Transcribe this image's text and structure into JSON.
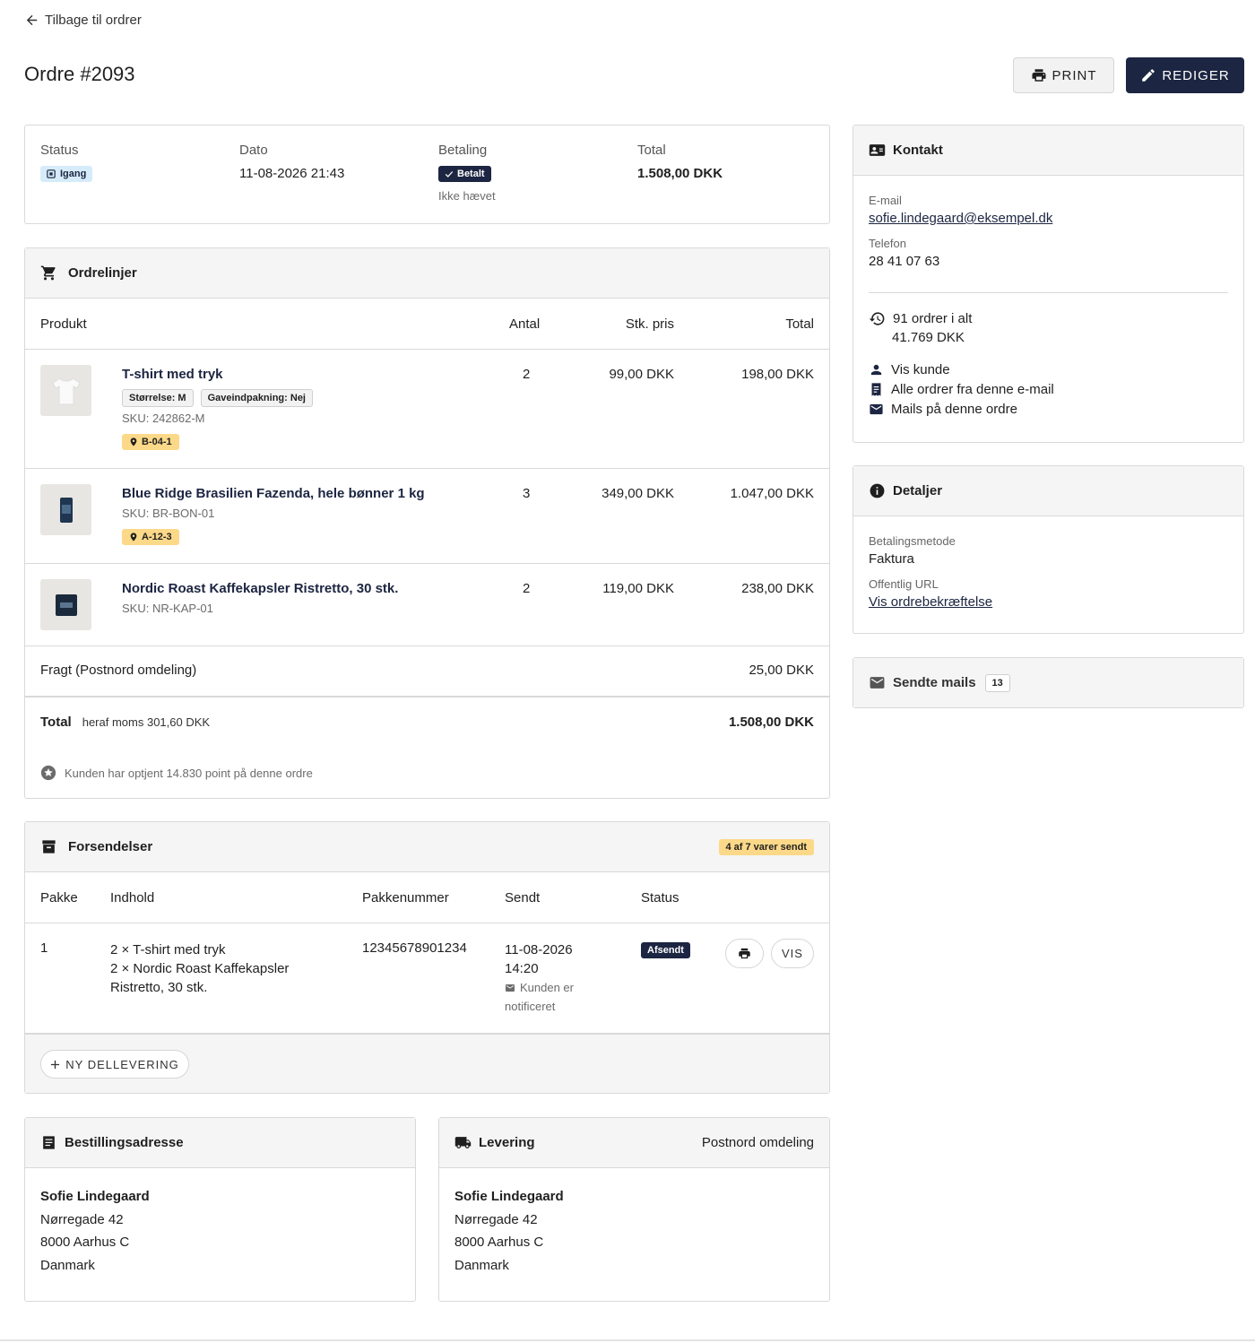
{
  "header": {
    "back_label": "Tilbage til ordrer",
    "title": "Ordre #2093",
    "print_label": "PRINT",
    "edit_label": "REDIGER"
  },
  "summary": {
    "status_label": "Status",
    "status_value": "Igang",
    "date_label": "Dato",
    "date_value": "11-08-2026 21:43",
    "payment_label": "Betaling",
    "payment_value": "Betalt",
    "payment_note": "Ikke hævet",
    "total_label": "Total",
    "total_value": "1.508,00 DKK"
  },
  "orderlines": {
    "title": "Ordrelinjer",
    "columns": [
      "Produkt",
      "Antal",
      "Stk. pris",
      "Total"
    ],
    "items": [
      {
        "name": "T-shirt med tryk",
        "chips": [
          "Størrelse: M",
          "Gaveindpakning: Nej"
        ],
        "sku": "SKU: 242862-M",
        "location": "B-04-1",
        "qty": "2",
        "unit_price": "99,00 DKK",
        "total": "198,00 DKK"
      },
      {
        "name": "Blue Ridge Brasilien Fazenda, hele bønner 1 kg",
        "sku": "SKU: BR-BON-01",
        "location": "A-12-3",
        "qty": "3",
        "unit_price": "349,00 DKK",
        "total": "1.047,00 DKK"
      },
      {
        "name": "Nordic Roast Kaffekapsler Ristretto, 30 stk.",
        "sku": "SKU: NR-KAP-01",
        "qty": "2",
        "unit_price": "119,00 DKK",
        "total": "238,00 DKK"
      }
    ],
    "shipping_label": "Fragt (Postnord omdeling)",
    "shipping_value": "25,00 DKK",
    "total_label": "Total",
    "vat_note": "heraf moms 301,60 DKK",
    "total_value": "1.508,00 DKK",
    "points_note": "Kunden har optjent 14.830 point på denne ordre"
  },
  "shipments": {
    "title": "Forsendelser",
    "badge": "4 af 7 varer sendt",
    "columns": [
      "Pakke",
      "Indhold",
      "Pakkenummer",
      "Sendt",
      "Status"
    ],
    "rows": [
      {
        "package": "1",
        "content_1": "2 × T-shirt med tryk",
        "content_2": "2 × Nordic Roast Kaffekapsler",
        "content_3": "Ristretto, 30 stk.",
        "tracking": "12345678901234",
        "sent_date": "11-08-2026",
        "sent_time": "14:20",
        "notified_1": "Kunden er",
        "notified_2": "notificeret",
        "status": "Afsendt",
        "view_label": "VIS"
      }
    ],
    "new_label": "NY DELLEVERING"
  },
  "billing": {
    "title": "Bestillingsadresse",
    "name": "Sofie Lindegaard",
    "street": "Nørregade 42",
    "city": "8000 Aarhus C",
    "country": "Danmark"
  },
  "delivery": {
    "title": "Levering",
    "method": "Postnord omdeling",
    "name": "Sofie Lindegaard",
    "street": "Nørregade 42",
    "city": "8000 Aarhus C",
    "country": "Danmark"
  },
  "contact": {
    "title": "Kontakt",
    "email_label": "E-mail",
    "email": "sofie.lindegaard@eksempel.dk",
    "phone_label": "Telefon",
    "phone": "28 41 07 63",
    "orders_count": "91 ordrer i alt",
    "orders_total": "41.769 DKK",
    "link_customer": "Vis kunde",
    "link_all_orders": "Alle ordrer fra denne e-mail",
    "link_mails": "Mails på denne ordre"
  },
  "details": {
    "title": "Detaljer",
    "method_label": "Betalingsmetode",
    "method": "Faktura",
    "url_label": "Offentlig URL",
    "url_text": "Vis ordrebekræftelse"
  },
  "mails": {
    "title": "Sendte mails",
    "count": "13"
  },
  "colors": {
    "navy": "#1c2541",
    "badge_yellow": "#fcd989",
    "badge_blue": "#d6ecfa"
  }
}
